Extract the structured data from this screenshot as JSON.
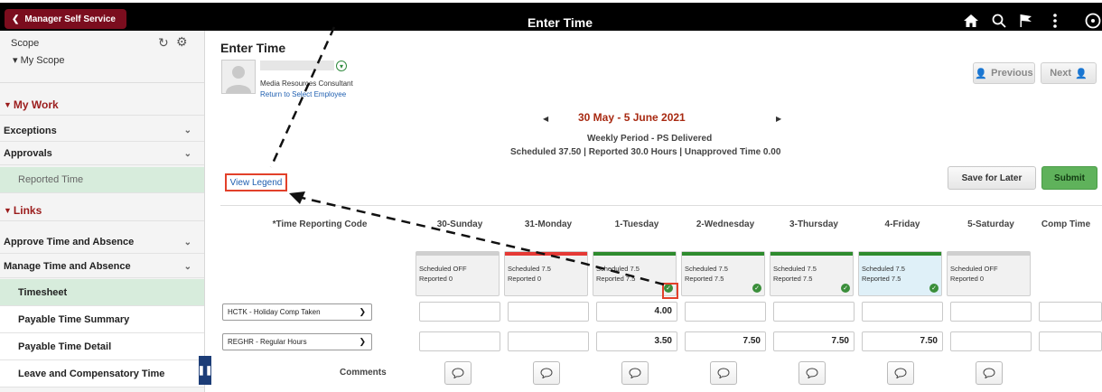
{
  "topbar": {
    "back_label": "Manager Self Service",
    "title": "Enter Time",
    "icons": [
      "home-icon",
      "search-icon",
      "flag-icon",
      "more-icon",
      "compass-icon"
    ]
  },
  "sidebar": {
    "scope_label": "Scope",
    "scope_value": "▾ My Scope",
    "my_work_header": "My Work",
    "exceptions": "Exceptions",
    "approvals": "Approvals",
    "reported_time": "Reported Time",
    "links_header": "Links",
    "approve_time": "Approve Time and Absence",
    "manage_time": "Manage Time and Absence",
    "timesheet": "Timesheet",
    "payable_summary": "Payable Time Summary",
    "payable_detail": "Payable Time Detail",
    "leave_comp": "Leave and Compensatory Time"
  },
  "page": {
    "title": "Enter Time",
    "employee_title": "Media Resources Consultant",
    "return_link": "Return to Select Employee",
    "previous_label": "Previous",
    "next_label": "Next",
    "period_title": "30 May - 5 June 2021",
    "period_sub": "Weekly Period - PS Delivered",
    "period_summary": "Scheduled  37.50 | Reported  30.0 Hours | Unapproved Time  0.00",
    "view_legend": "View Legend",
    "save_for_later": "Save for Later",
    "submit": "Submit",
    "trc_header": "*Time Reporting Code",
    "comments_label": "Comments"
  },
  "days": [
    {
      "header": "30-Sunday",
      "scheduled": "Scheduled OFF",
      "reported": "Reported  0",
      "bar": "#cfcfcf",
      "ok": false,
      "highlight": false
    },
    {
      "header": "31-Monday",
      "scheduled": "Scheduled 7.5",
      "reported": "Reported  0",
      "bar": "#e53935",
      "ok": false,
      "highlight": false
    },
    {
      "header": "1-Tuesday",
      "scheduled": "Scheduled 7.5",
      "reported": "Reported  7.5",
      "bar": "#2e8b2e",
      "ok": true,
      "highlight": false
    },
    {
      "header": "2-Wednesday",
      "scheduled": "Scheduled 7.5",
      "reported": "Reported  7.5",
      "bar": "#2e8b2e",
      "ok": true,
      "highlight": false
    },
    {
      "header": "3-Thursday",
      "scheduled": "Scheduled 7.5",
      "reported": "Reported  7.5",
      "bar": "#2e8b2e",
      "ok": true,
      "highlight": false
    },
    {
      "header": "4-Friday",
      "scheduled": "Scheduled 7.5",
      "reported": "Reported  7.5",
      "bar": "#2e8b2e",
      "ok": true,
      "highlight": true
    },
    {
      "header": "5-Saturday",
      "scheduled": "Scheduled OFF",
      "reported": "Reported  0",
      "bar": "#cfcfcf",
      "ok": false,
      "highlight": false
    }
  ],
  "comp_time_header": "Comp Time",
  "rows": [
    {
      "code": "HCTK - Holiday Comp Taken",
      "values": [
        "",
        "",
        "4.00",
        "",
        "",
        "",
        ""
      ]
    },
    {
      "code": "REGHR - Regular Hours",
      "values": [
        "",
        "",
        "3.50",
        "7.50",
        "7.50",
        "7.50",
        ""
      ]
    }
  ],
  "colors": {
    "brand": "#7b0d1e",
    "accent_green": "#5fb25b",
    "link": "#1f5fb0",
    "annotation": "#e2402a"
  }
}
